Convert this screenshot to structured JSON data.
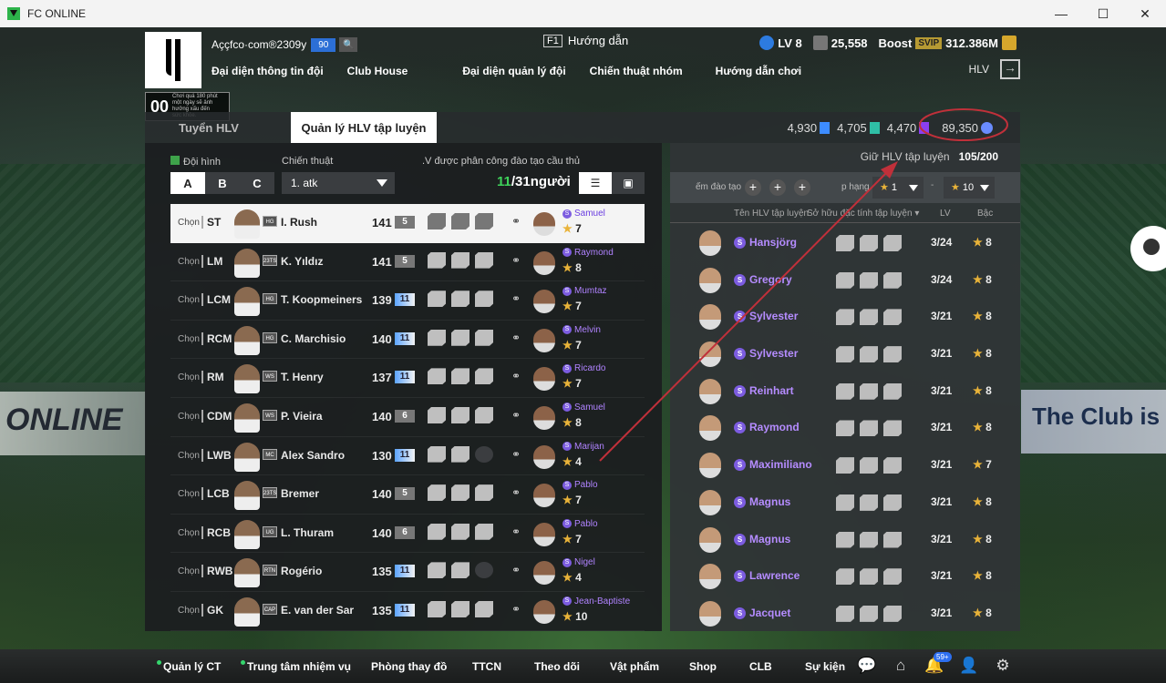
{
  "window": {
    "title": "FC ONLINE",
    "minimize": "—",
    "maximize": "☐",
    "close": "✕"
  },
  "header": {
    "account_name": "Aççfco·com®2309y",
    "account_level": "90",
    "guide_key": "F1",
    "guide_label": "Hướng dẫn",
    "user_level": "LV 8",
    "team_value": "25,558",
    "boost_label": "Boost",
    "svip_label": "SVIP",
    "bp": "312.386M",
    "ovr_value": "00",
    "ovr_desc": "Chơi quá 180 phút một ngày sẽ ảnh hưởng xấu đến sức khỏe.",
    "hlv_label": "HLV"
  },
  "nav": {
    "items": [
      "Đại diện thông tin đội",
      "Club House",
      "Đại diện quản lý đội",
      "Chiến thuật nhóm",
      "Hướng dẫn chơi"
    ]
  },
  "tabs": {
    "inactive": "Tuyển HLV",
    "active": "Quản lý HLV tập luyện"
  },
  "currencies": {
    "a": "4,930",
    "b": "4,705",
    "c": "4,470",
    "d": "89,350"
  },
  "left": {
    "formation_label": "Đội hình",
    "formation_options": [
      "A",
      "B",
      "C"
    ],
    "tactic_label": "Chiến thuật",
    "tactic_value": "1. atk",
    "assign_label": ".V được phân công đào tạo cầu thủ",
    "assign_current": "11",
    "assign_total": "/31người",
    "rows": [
      {
        "select": "Chọn",
        "pos": "ST",
        "season": "HG",
        "name": "I. Rush",
        "ovr": "141",
        "lvl": "5",
        "coach": "Samuel",
        "stars": "7",
        "blue": false
      },
      {
        "select": "Chọn",
        "pos": "LM",
        "season": "23TS",
        "name": "K. Yıldız",
        "ovr": "141",
        "lvl": "5",
        "coach": "Raymond",
        "stars": "8",
        "blue": false
      },
      {
        "select": "Chọn",
        "pos": "LCM",
        "season": "HG",
        "name": "T. Koopmeiners",
        "ovr": "139",
        "lvl": "11",
        "coach": "Mumtaz",
        "stars": "7",
        "blue": true
      },
      {
        "select": "Chọn",
        "pos": "RCM",
        "season": "HG",
        "name": "C. Marchisio",
        "ovr": "140",
        "lvl": "11",
        "coach": "Melvin",
        "stars": "7",
        "blue": true
      },
      {
        "select": "Chọn",
        "pos": "RM",
        "season": "WS",
        "name": "T. Henry",
        "ovr": "137",
        "lvl": "11",
        "coach": "Ricardo",
        "stars": "7",
        "blue": true
      },
      {
        "select": "Chọn",
        "pos": "CDM",
        "season": "WS",
        "name": "P. Vieira",
        "ovr": "140",
        "lvl": "6",
        "coach": "Samuel",
        "stars": "8",
        "blue": false
      },
      {
        "select": "Chọn",
        "pos": "LWB",
        "season": "MC",
        "name": "Alex Sandro",
        "ovr": "130",
        "lvl": "11",
        "coach": "Marijan",
        "stars": "4",
        "blue": true
      },
      {
        "select": "Chọn",
        "pos": "LCB",
        "season": "23TS",
        "name": "Bremer",
        "ovr": "140",
        "lvl": "5",
        "coach": "Pablo",
        "stars": "7",
        "blue": false
      },
      {
        "select": "Chọn",
        "pos": "RCB",
        "season": "UG",
        "name": "L. Thuram",
        "ovr": "140",
        "lvl": "6",
        "coach": "Pablo",
        "stars": "7",
        "blue": false
      },
      {
        "select": "Chọn",
        "pos": "RWB",
        "season": "RTN",
        "name": "Rogério",
        "ovr": "135",
        "lvl": "11",
        "coach": "Nigel",
        "stars": "4",
        "blue": true
      },
      {
        "select": "Chọn",
        "pos": "GK",
        "season": "CAP",
        "name": "E. van der Sar",
        "ovr": "135",
        "lvl": "11",
        "coach": "Jean-Baptiste",
        "stars": "10",
        "blue": true
      }
    ]
  },
  "right": {
    "hold_label": "Giữ HLV tập luyện",
    "hold_value": "105/200",
    "filter_training": "ếm đào tạo",
    "filter_rank": "p hạng",
    "rank_from": "1",
    "rank_to": "10",
    "plus": "+",
    "dash": "-",
    "col_name": "Tên HLV tập luyện",
    "col_trait": "Sở hữu đặc tính tập luyện ▾",
    "col_lv": "LV",
    "col_rank": "Bậc",
    "coaches": [
      {
        "name": "Hansjörg",
        "lv": "3/24",
        "rank": "8"
      },
      {
        "name": "Gregory",
        "lv": "3/24",
        "rank": "8"
      },
      {
        "name": "Sylvester",
        "lv": "3/21",
        "rank": "8"
      },
      {
        "name": "Sylvester",
        "lv": "3/21",
        "rank": "8"
      },
      {
        "name": "Reinhart",
        "lv": "3/21",
        "rank": "8"
      },
      {
        "name": "Raymond",
        "lv": "3/21",
        "rank": "8"
      },
      {
        "name": "Maximiliano",
        "lv": "3/21",
        "rank": "7"
      },
      {
        "name": "Magnus",
        "lv": "3/21",
        "rank": "8"
      },
      {
        "name": "Magnus",
        "lv": "3/21",
        "rank": "8"
      },
      {
        "name": "Lawrence",
        "lv": "3/21",
        "rank": "8"
      },
      {
        "name": "Jacquet",
        "lv": "3/21",
        "rank": "8"
      }
    ]
  },
  "background": {
    "stand_left": "ONLINE",
    "stand_right": "The Club is Y"
  },
  "bottom": {
    "items": [
      "Quản lý CT",
      "Trung tâm nhiệm vụ",
      "Phòng thay đồ",
      "TTCN",
      "Theo dõi",
      "Vật phẩm",
      "Shop",
      "CLB",
      "Sự kiện"
    ],
    "notif_badge": "59+"
  },
  "colors": {
    "accent_purple": "#b58cff",
    "annotation_red": "#c0303a",
    "star": "#e9b339",
    "assign_green": "#3ed25a"
  }
}
